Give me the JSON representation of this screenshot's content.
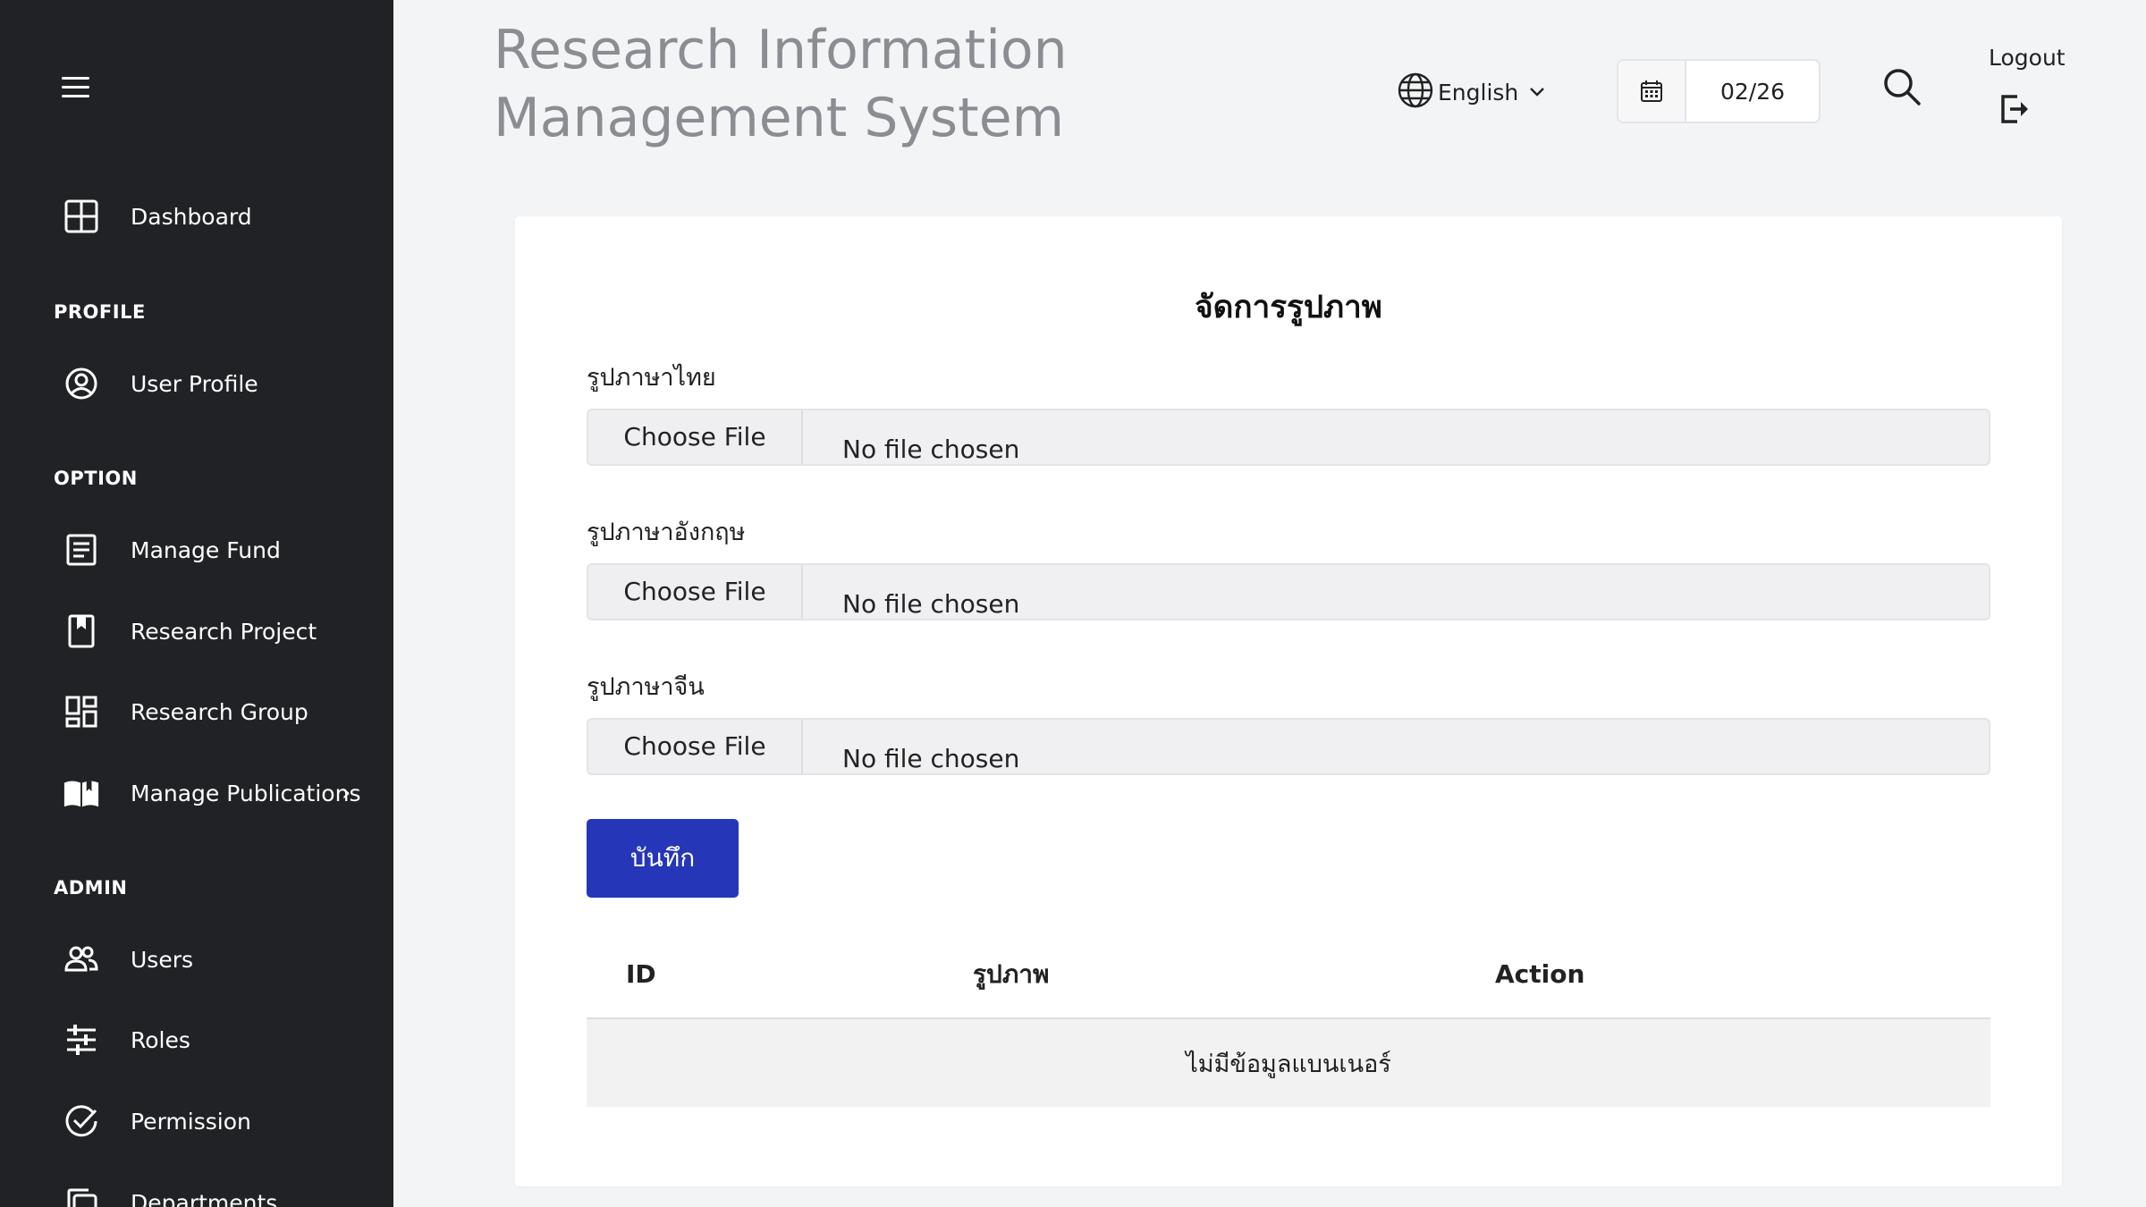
{
  "header": {
    "title": "Research Information Management System",
    "language": "English",
    "date_value": "02/26",
    "logout_label": "Logout"
  },
  "sidebar": {
    "dashboard": "Dashboard",
    "sections": {
      "profile": "PROFILE",
      "option": "OPTION",
      "admin": "ADMIN"
    },
    "items": {
      "user_profile": "User Profile",
      "manage_fund": "Manage Fund",
      "research_project": "Research Project",
      "research_group": "Research Group",
      "manage_publications": "Manage Publications",
      "users": "Users",
      "roles": "Roles",
      "permission": "Permission",
      "departments": "Departments"
    }
  },
  "main": {
    "card_title": "จัดการรูปภาพ",
    "fields": [
      {
        "label": "รูปภาษาไทย",
        "button": "Choose File",
        "status": "No file chosen"
      },
      {
        "label": "รูปภาษาอังกฤษ",
        "button": "Choose File",
        "status": "No file chosen"
      },
      {
        "label": "รูปภาษาจีน",
        "button": "Choose File",
        "status": "No file chosen"
      }
    ],
    "save_label": "บันทึก",
    "table": {
      "columns": [
        "ID",
        "รูปภาพ",
        "Action"
      ],
      "empty_message": "ไม่มีข้อมูลแบนเนอร์"
    }
  },
  "colors": {
    "sidebar_bg": "#212226",
    "page_bg": "#f3f4f6",
    "primary_button": "#2536b8",
    "title_gray": "#8a8d92"
  },
  "icons": [
    "menu-icon",
    "dashboard-icon",
    "user-circle-icon",
    "document-icon",
    "bookmark-icon",
    "grid-icon",
    "book-open-icon",
    "users-icon",
    "sliders-icon",
    "check-circle-icon",
    "copy-icon",
    "globe-icon",
    "chevron-down-icon",
    "calendar-icon",
    "search-icon",
    "logout-icon"
  ]
}
